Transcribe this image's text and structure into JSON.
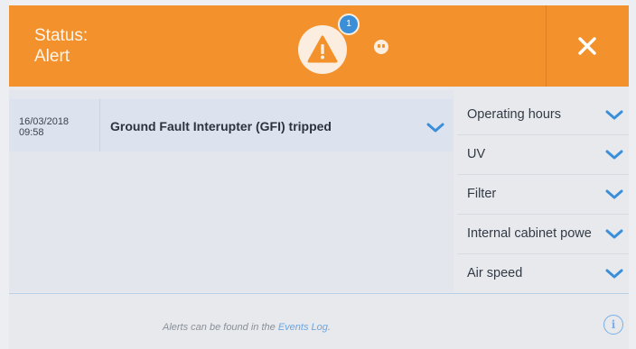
{
  "header": {
    "status_label": "Status:",
    "status_value": "Alert",
    "badge_count": "1",
    "close_icon": "close-icon",
    "alert_icon": "warning-triangle-icon",
    "plug_icon": "power-plug-icon",
    "background_color": "#f3922d"
  },
  "alert": {
    "date": "16/03/2018",
    "time": "09:58",
    "message": "Ground Fault Interupter (GFI) tripped"
  },
  "panel": {
    "items": [
      {
        "label": "Operating hours"
      },
      {
        "label": "UV"
      },
      {
        "label": "Filter"
      },
      {
        "label": "Internal cabinet powe"
      },
      {
        "label": "Air speed"
      }
    ]
  },
  "footer": {
    "note_prefix": "Alerts can be found in the ",
    "note_link": "Events Log",
    "note_suffix": ".",
    "info_symbol": "i"
  },
  "colors": {
    "accent": "#3b8fd9",
    "header": "#f3922d"
  }
}
